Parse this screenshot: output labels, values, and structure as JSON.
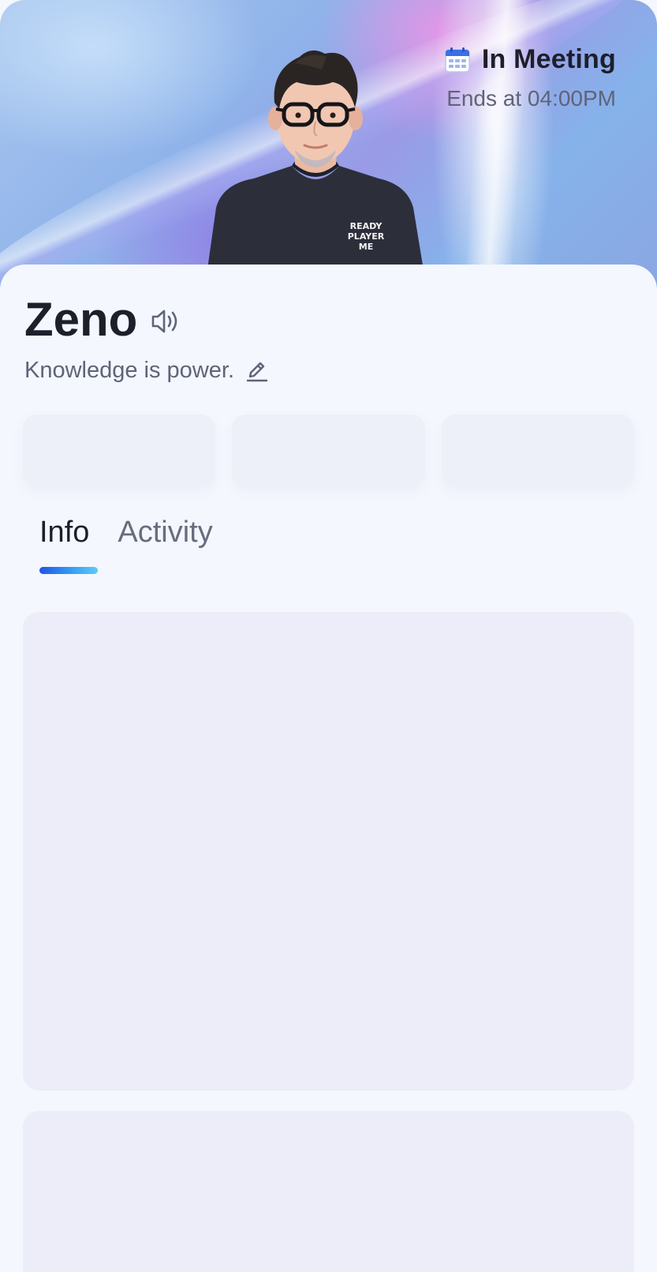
{
  "profile": {
    "name": "Zeno",
    "bio": "Knowledge is power.",
    "avatar_shirt_text": [
      "READY",
      "PLAYER",
      "ME"
    ]
  },
  "status": {
    "label": "In Meeting",
    "ends": "Ends at 04:00PM",
    "icon": "calendar-icon"
  },
  "tabs": [
    {
      "label": "Info",
      "active": true
    },
    {
      "label": "Activity",
      "active": false
    }
  ],
  "colors": {
    "accent_start": "#1f55e6",
    "accent_end": "#5ccbf7",
    "text_primary": "#1d1f2b",
    "text_secondary": "#5e6478",
    "placeholder": "#ecedf9"
  }
}
